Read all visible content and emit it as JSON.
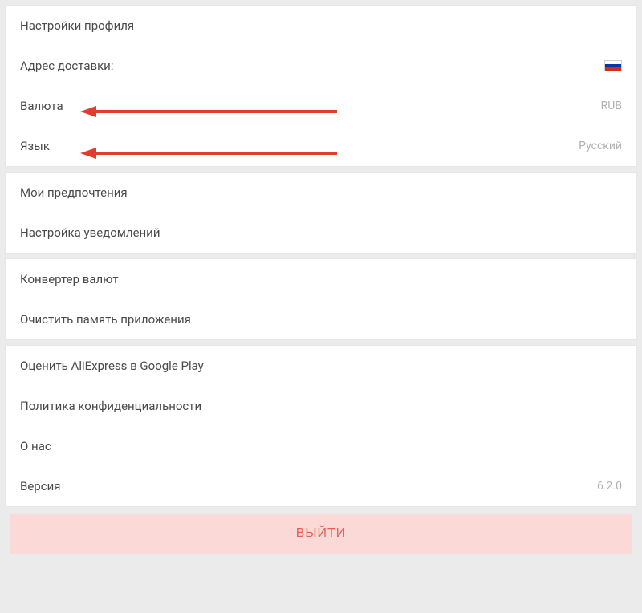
{
  "group1": {
    "profile_settings": "Настройки профиля",
    "shipping_address_label": "Адрес доставки:",
    "currency_label": "Валюта",
    "currency_value": "RUB",
    "language_label": "Язык",
    "language_value": "Русский"
  },
  "group2": {
    "preferences": "Мои предпочтения",
    "notifications": "Настройка уведомлений"
  },
  "group3": {
    "currency_converter": "Конвертер валют",
    "clear_cache": "Очистить память приложения"
  },
  "group4": {
    "rate_app": "Оценить AliExpress в Google Play",
    "privacy_policy": "Политика конфиденциальности",
    "about": "О нас",
    "version_label": "Версия",
    "version_value": "6.2.0"
  },
  "logout_label": "ВЫЙТИ"
}
